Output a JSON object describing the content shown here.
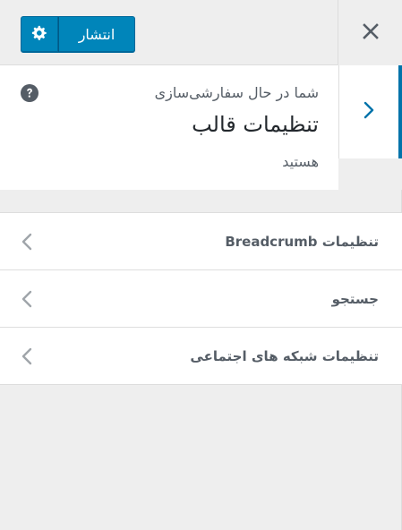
{
  "header": {
    "publish_label": "انتشار",
    "settings_icon": "gear-icon",
    "close_icon": "close-icon"
  },
  "info": {
    "pre_text": "شما در حال سفارشی‌سازی",
    "title": "تنظیمات قالب",
    "post_text": "هستید",
    "help_icon": "help-icon",
    "back_icon": "chevron-right-icon"
  },
  "sections": [
    {
      "label": "تنظیمات Breadcrumb"
    },
    {
      "label": "جستجو"
    },
    {
      "label": "تنظیمات شبکه های اجتماعی"
    }
  ],
  "colors": {
    "accent": "#0085ba",
    "accent_border": "#006799",
    "active_bar": "#0073aa",
    "background": "#eeeeee"
  }
}
